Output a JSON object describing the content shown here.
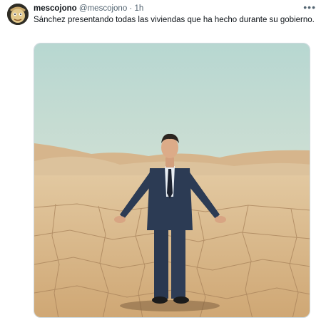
{
  "tweet": {
    "display_name": "mescojono",
    "handle": "@mescojono",
    "separator": "·",
    "time": "1h",
    "more_label": "•••",
    "text": "Sánchez presentando todas las viviendas que ha hecho durante su gobierno.",
    "avatar_icon": "avatar-cartoon-icon",
    "media_description_icon": "photo-man-in-desert-image"
  },
  "colors": {
    "text": "#0f1419",
    "secondary": "#536471",
    "sky_top": "#b9d8d2",
    "sky_bottom": "#e6e8d8",
    "sand": "#d9b889",
    "suit": "#2c3b52"
  }
}
